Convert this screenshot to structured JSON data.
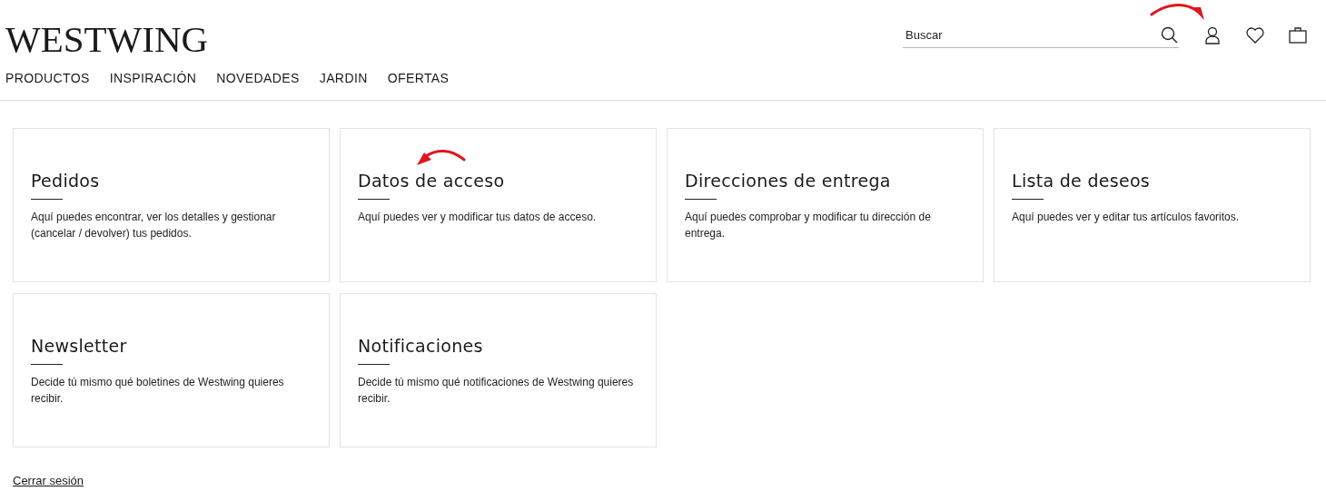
{
  "header": {
    "logo": "WESTWING",
    "search": {
      "placeholder": "Buscar"
    }
  },
  "nav": [
    "PRODUCTOS",
    "INSPIRACIÓN",
    "NOVEDADES",
    "JARDIN",
    "OFERTAS"
  ],
  "cards": [
    {
      "title": "Pedidos",
      "description": "Aquí puedes encontrar, ver los detalles y gestionar (cancelar / devolver) tus pedidos.",
      "highlighted": false
    },
    {
      "title": "Datos de acceso",
      "description": "Aquí puedes ver y modificar tus datos de acceso.",
      "highlighted": true
    },
    {
      "title": "Direcciones de entrega",
      "description": "Aquí puedes comprobar y modificar tu dirección de entrega.",
      "highlighted": false
    },
    {
      "title": "Lista de deseos",
      "description": "Aquí puedes ver y editar tus artículos favoritos.",
      "highlighted": false
    },
    {
      "title": "Newsletter",
      "description": "Decide tú mismo qué boletines de Westwing quieres recibir.",
      "highlighted": false
    },
    {
      "title": "Notificaciones",
      "description": "Decide tú mismo qué notificaciones de Westwing quieres recibir.",
      "highlighted": false
    }
  ],
  "logout": "Cerrar sesión"
}
